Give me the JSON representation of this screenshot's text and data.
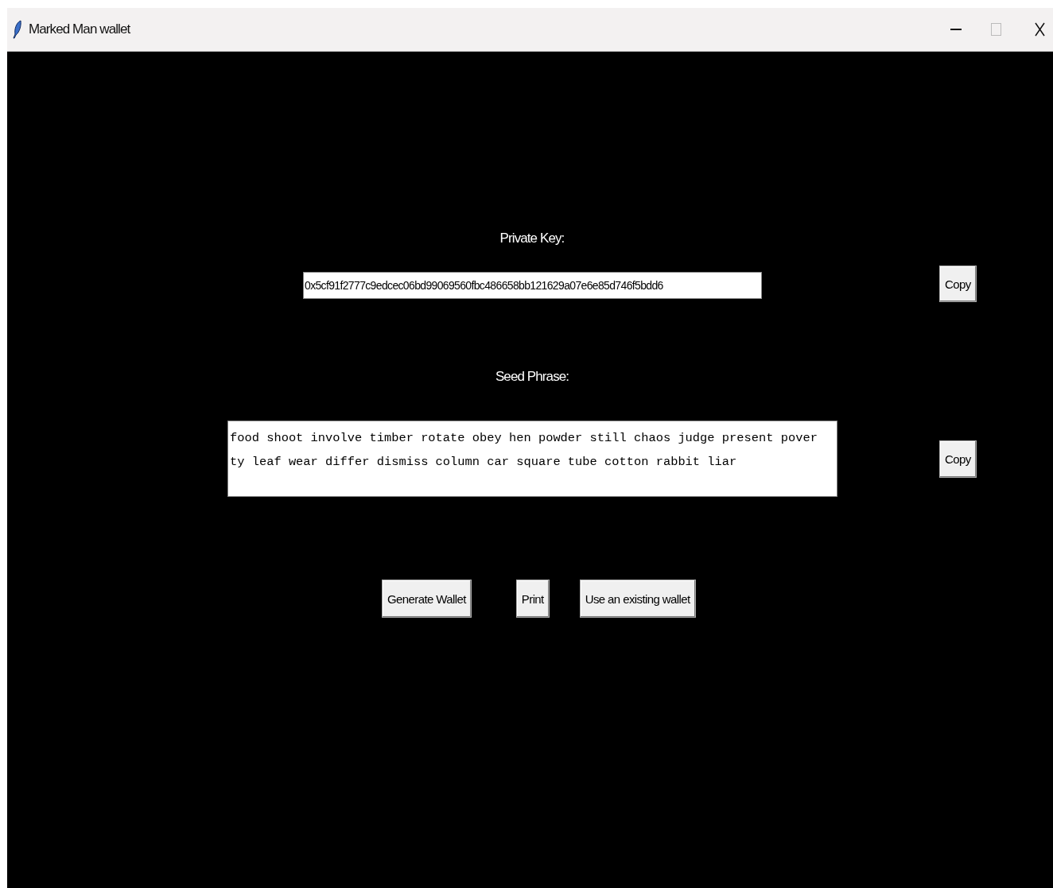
{
  "window": {
    "title": "Marked Man wallet"
  },
  "private_key": {
    "label": "Private Key:",
    "value": "0x5cf91f2777c9edcec06bd99069560fbc486658bb121629a07e6e85d746f5bdd6",
    "copy_button": "Copy"
  },
  "seed_phrase": {
    "label": "Seed Phrase:",
    "lines": [
      "food shoot involve timber rotate obey hen powder still chaos judge present pover",
      "ty leaf wear differ dismiss column car square tube cotton rabbit liar"
    ],
    "copy_button": "Copy"
  },
  "buttons": [
    "Generate Wallet",
    "Print",
    "Use an existing wallet"
  ]
}
